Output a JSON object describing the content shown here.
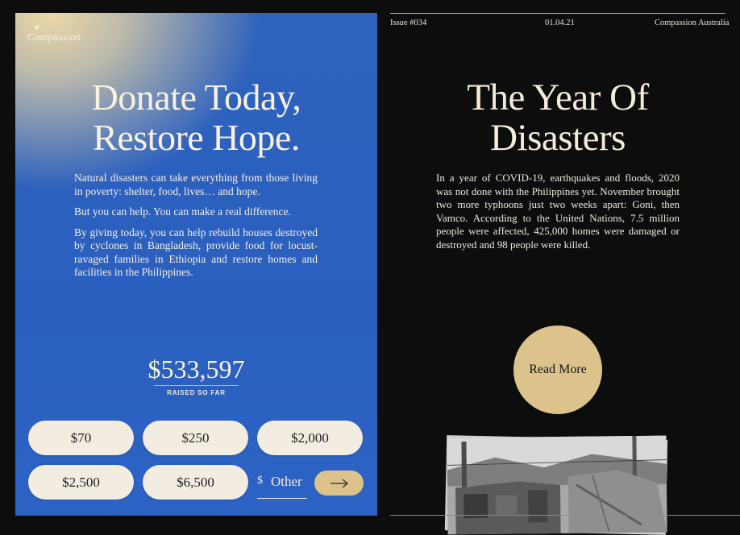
{
  "donate": {
    "logo": "Compassion",
    "headline_line1": "Donate Today,",
    "headline_line2": "Restore Hope.",
    "paragraphs": [
      "Natural disasters can take everything from those living in poverty: shelter, food, lives… and hope.",
      "But you can help. You can make a real difference.",
      "By giving today, you can help rebuild houses destroyed by cyclones in Bangladesh, provide food for locust-ravaged families in Ethiopia and restore homes and facilities in the Philippines."
    ],
    "raised_amount": "$533,597",
    "raised_label": "RAISED SO FAR",
    "amounts": [
      "$70",
      "$250",
      "$2,000",
      "$2,500",
      "$6,500"
    ],
    "other_currency": "$",
    "other_placeholder": "Other",
    "submit_icon": "arrow-right-icon"
  },
  "article": {
    "issue": "Issue #034",
    "date": "01.04.21",
    "publisher": "Compassion Australia",
    "title_line1": "The Year Of",
    "title_line2": "Disasters",
    "body": "In a year of COVID-19, earthquakes and floods, 2020 was not done with the Philippines yet. November brought two more typhoons just two weeks apart: Goni, then Vamco. According to the United Nations, 7.5 million people were affected, 425,000 homes were damaged or destroyed and 98 people were killed.",
    "read_more": "Read More"
  },
  "colors": {
    "panel_blue": "#2e62bd",
    "panel_gold": "#ecd8a6",
    "accent_gold": "#dbc38b",
    "background": "#0d0d0e",
    "button_cream": "#f3ede1"
  }
}
